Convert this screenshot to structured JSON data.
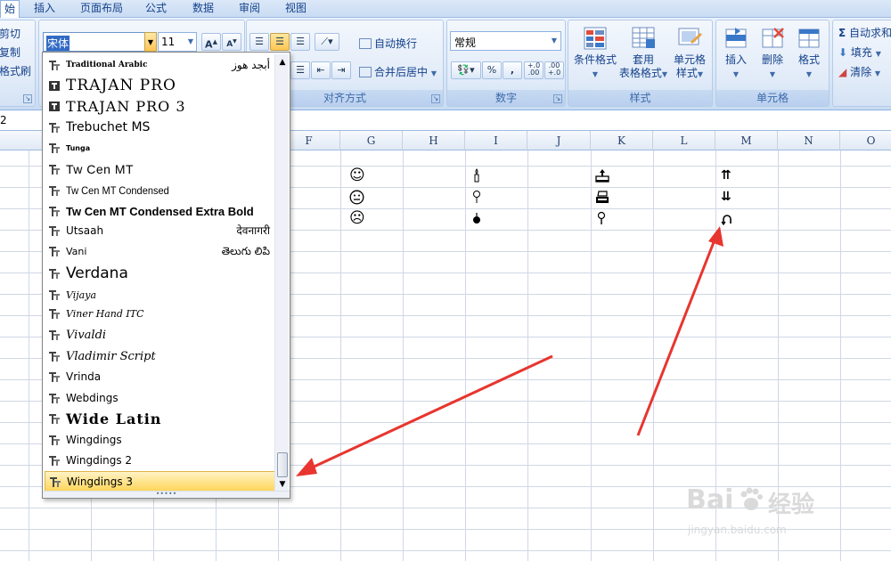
{
  "tabs": [
    "始",
    "插入",
    "页面布局",
    "公式",
    "数据",
    "审阅",
    "视图"
  ],
  "clipboard": {
    "cut": "剪切",
    "copy": "复制",
    "painter": "格式刷"
  },
  "font": {
    "name": "宋体",
    "size": "11",
    "grow": "A",
    "shrink": "A"
  },
  "align": {
    "wrap": "自动换行",
    "merge": "合并后居中",
    "label": "对齐方式"
  },
  "number": {
    "format": "常规",
    "percent": "%",
    "comma": ",",
    "inc": "+.0\n.00",
    "dec": ".00\n+.0",
    "label": "数字"
  },
  "styles": {
    "conditional": "条件格式",
    "table1": "套用",
    "table2": "表格格式",
    "cell1": "单元格",
    "cell2": "样式",
    "label": "样式"
  },
  "cells": {
    "insert": "插入",
    "delete": "删除",
    "format": "格式",
    "label": "单元格"
  },
  "editing": {
    "sum": "自动求和",
    "fill": "填充",
    "clear": "清除",
    "sigma": "Σ"
  },
  "formula_bar": {
    "ref": "2"
  },
  "columns": [
    "F",
    "G",
    "H",
    "I",
    "J",
    "K",
    "L",
    "M",
    "N",
    "O"
  ],
  "fonts": [
    {
      "name": "Traditional Arabic",
      "sample": "أبجد هوز"
    },
    {
      "name": "TRAJAN PRO",
      "sample": ""
    },
    {
      "name": "TRAJAN PRO 3",
      "sample": ""
    },
    {
      "name": "Trebuchet MS",
      "sample": ""
    },
    {
      "name": "Tunga",
      "sample": ""
    },
    {
      "name": "Tw Cen MT",
      "sample": ""
    },
    {
      "name": "Tw Cen MT Condensed",
      "sample": ""
    },
    {
      "name": "Tw Cen MT Condensed Extra Bold",
      "sample": ""
    },
    {
      "name": "Utsaah",
      "sample": "देवनागरी"
    },
    {
      "name": "Vani",
      "sample": "తెలుగు లిపి"
    },
    {
      "name": "Verdana",
      "sample": ""
    },
    {
      "name": "Vijaya",
      "sample": ""
    },
    {
      "name": "Viner Hand ITC",
      "sample": ""
    },
    {
      "name": "Vivaldi",
      "sample": ""
    },
    {
      "name": "Vladimir Script",
      "sample": ""
    },
    {
      "name": "Vrinda",
      "sample": ""
    },
    {
      "name": "Webdings",
      "sample": ""
    },
    {
      "name": "Wide Latin",
      "sample": ""
    },
    {
      "name": "Wingdings",
      "sample": ""
    },
    {
      "name": "Wingdings 2",
      "sample": ""
    },
    {
      "name": "Wingdings 3",
      "sample": ""
    }
  ],
  "cells_content": {
    "g1": "☺",
    "g2": "😐",
    "g3": "☹",
    "i1": "🕯",
    "i2": "🕯",
    "i3": "🕯",
    "k1": "⛟",
    "k2": "⛟",
    "k3": "⚲",
    "m1": "⇈",
    "m2": "⇊",
    "m3": "↶"
  },
  "watermark": {
    "brand": "Bai",
    "brand2": "经验",
    "url": "jingyan.baidu.com"
  },
  "colors": {
    "arrow": "#e8352f",
    "selection": "#ffd65c"
  }
}
